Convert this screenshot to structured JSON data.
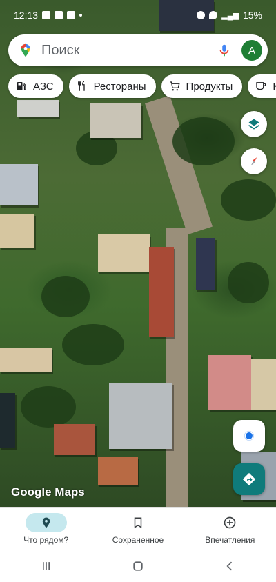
{
  "status_bar": {
    "time": "12:13",
    "battery": "15%"
  },
  "search": {
    "placeholder": "Поиск",
    "avatar_letter": "A"
  },
  "chips": [
    {
      "label": "АЗС",
      "icon": "gas-station-icon"
    },
    {
      "label": "Рестораны",
      "icon": "restaurant-icon"
    },
    {
      "label": "Продукты",
      "icon": "cart-icon"
    },
    {
      "label": "К",
      "icon": "cafe-icon"
    }
  ],
  "map": {
    "attribution": "Google Maps",
    "layer": "satellite"
  },
  "bottom_nav": [
    {
      "label": "Что рядом?",
      "icon": "location-pin-icon",
      "active": true
    },
    {
      "label": "Сохраненное",
      "icon": "bookmark-icon",
      "active": false
    },
    {
      "label": "Впечатления",
      "icon": "plus-circle-icon",
      "active": false
    }
  ],
  "colors": {
    "accent": "#0f7b7b",
    "active_tab": "#c5e8ee",
    "avatar": "#1e7e34"
  }
}
